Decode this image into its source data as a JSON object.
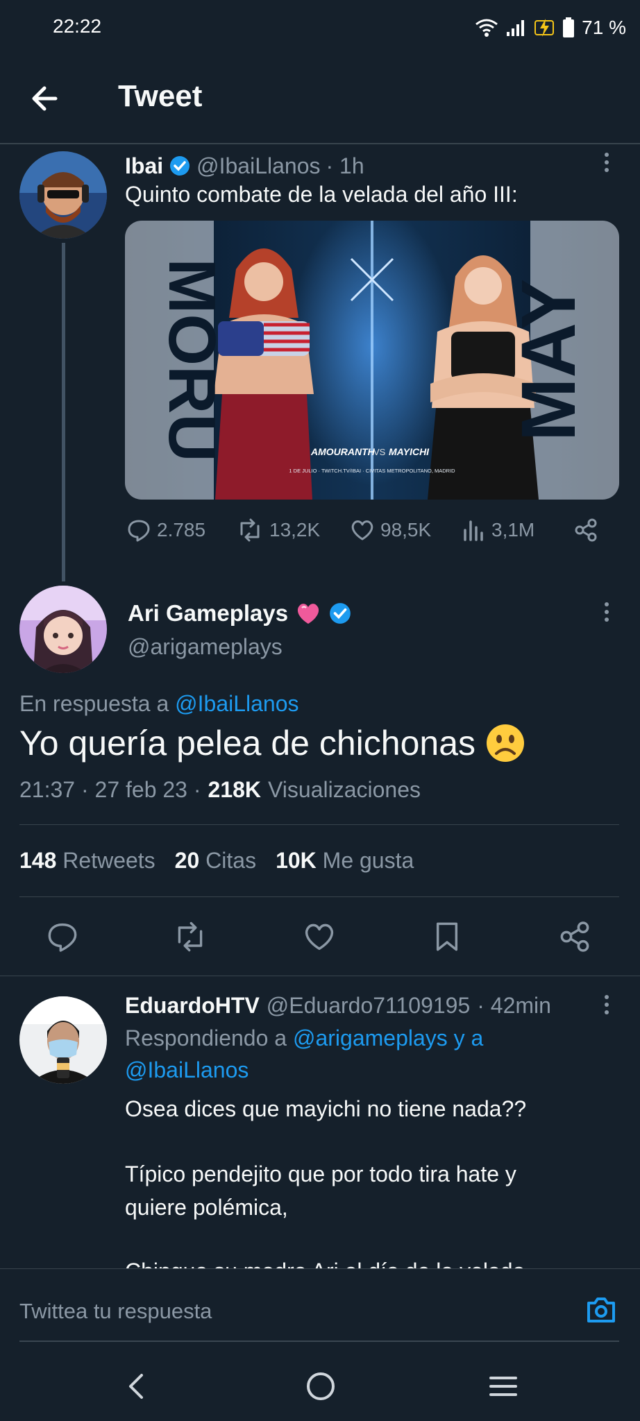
{
  "status_bar": {
    "time": "22:22",
    "battery": "71 %"
  },
  "header": {
    "title": "Tweet"
  },
  "parent_tweet": {
    "author_name": "Ibai",
    "handle": "@IbaiLlanos",
    "time": "· 1h",
    "text": "Quinto combate de la velada del año III:",
    "media": {
      "left_vertical_text": "MORU",
      "right_vertical_text": "MAY",
      "fight_title_a": "AMOURANTH",
      "fight_vs": "VS",
      "fight_title_b": "MAYICHI",
      "fight_subtitle": "1 DE JULIO · TWITCH.TV/IBAI · CIVITAS METROPOLITANO, MADRID"
    },
    "stats": {
      "replies": "2.785",
      "retweets": "13,2K",
      "likes": "98,5K",
      "views": "3,1M"
    }
  },
  "main_tweet": {
    "author_name": "Ari Gameplays",
    "handle": "@arigameplays",
    "reply_prefix": "En respuesta a",
    "reply_to": "@IbaiLlanos",
    "text": "Yo quería pelea de chichonas",
    "emoji": "☹️",
    "time": "21:37 · 27 feb 23 ·",
    "views_count": "218K",
    "views_label": "Visualizaciones",
    "retweets_count": "148",
    "retweets_label": "Retweets",
    "quotes_count": "20",
    "quotes_label": "Citas",
    "likes_count": "10K",
    "likes_label": "Me gusta"
  },
  "reply": {
    "author_name": "EduardoHTV",
    "handle": "@Eduardo71109195",
    "time": "· 42min",
    "replying_prefix": "Respondiendo a",
    "replying_to_1": "@arigameplays y a",
    "replying_to_2": "@IbaiLlanos",
    "line1": "Osea dices que mayichi no tiene nada??",
    "line2": "Típico pendejito que por todo tira hate y",
    "line3": "quiere polémica,",
    "line4": "Chingue su madre Ari el día de la velada"
  },
  "composer": {
    "placeholder": "Twittea tu respuesta"
  },
  "colors": {
    "background": "#15202b",
    "accent": "#1d9bf0",
    "muted": "#8b98a5",
    "divider": "#38444d",
    "heart": "#f91880"
  }
}
